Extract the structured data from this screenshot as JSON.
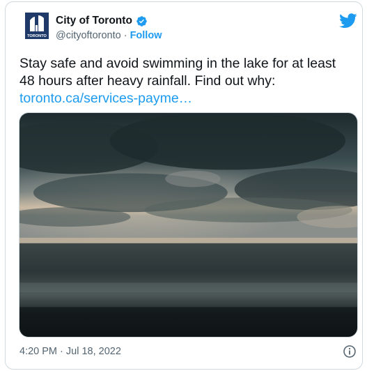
{
  "account": {
    "name": "City of Toronto",
    "handle": "@cityoftoronto",
    "separator": "·",
    "follow_label": "Follow",
    "avatar_text": "TORONTO",
    "avatar_icon": "city-hall-logo-icon",
    "verified_icon": "verified-badge-icon"
  },
  "tweet": {
    "text": "Stay safe and avoid swimming in the lake for at least 48 hours after heavy rainfall. Find out why:",
    "link": "toronto.ca/services-payme…",
    "image_icon": "stormy-lake-photo"
  },
  "footer": {
    "timestamp": "4:20 PM · Jul 18, 2022",
    "info_icon": "info-icon"
  },
  "brand": {
    "bird_icon": "twitter-bird-icon",
    "accent": "#1d9bf0",
    "text_primary": "#0f1419",
    "text_secondary": "#536471"
  }
}
